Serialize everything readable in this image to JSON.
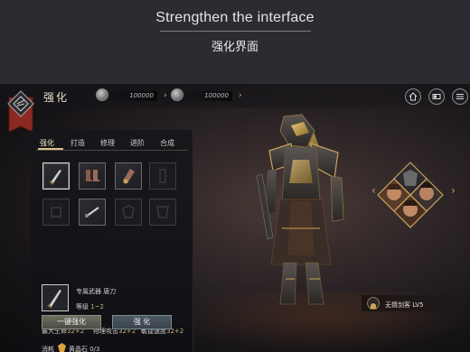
{
  "banner": {
    "title": "Strengthen the interface",
    "subtitle": "强化界面"
  },
  "header": {
    "title": "强化",
    "currency": [
      {
        "icon": "silver-coin-icon",
        "amount": "100000"
      },
      {
        "icon": "silver-coin-icon",
        "amount": "100000"
      }
    ],
    "right_buttons": [
      "home-icon",
      "card-icon",
      "menu-icon"
    ]
  },
  "tabs": [
    {
      "label": "强化",
      "active": true
    },
    {
      "label": "打造",
      "active": false
    },
    {
      "label": "修理",
      "active": false
    },
    {
      "label": "进阶",
      "active": false
    },
    {
      "label": "合成",
      "active": false
    }
  ],
  "equipment_slots": [
    {
      "icon": "blade-icon",
      "filled": true,
      "selected": true
    },
    {
      "icon": "boots-icon",
      "filled": true,
      "selected": false
    },
    {
      "icon": "gauntlet-icon",
      "filled": true,
      "selected": false
    },
    {
      "icon": "empty-slot-icon",
      "filled": false,
      "selected": false
    },
    {
      "icon": "empty-slot-icon",
      "filled": false,
      "selected": false
    },
    {
      "icon": "staff-icon",
      "filled": true,
      "selected": false
    },
    {
      "icon": "empty-slot-icon",
      "filled": false,
      "selected": false
    },
    {
      "icon": "empty-slot-icon",
      "filled": false,
      "selected": false
    }
  ],
  "item": {
    "name": "专属武器  唐刀",
    "level_label": "等级",
    "level_value": "1~2"
  },
  "stats": [
    {
      "label": "最大生命",
      "value": "32+2"
    },
    {
      "label": "物理攻击",
      "value": "32+2"
    },
    {
      "label": "敏捷速度",
      "value": "32+2"
    }
  ],
  "cost": {
    "label": "消耗",
    "item": "黄晶石 0/3"
  },
  "buttons": {
    "auto_enhance": "一键强化",
    "enhance": "强 化"
  },
  "character": {
    "name": "无情剑客 LV5"
  },
  "colors": {
    "accent_gold": "#c9b27a",
    "emblem_red": "#8c2a22"
  }
}
